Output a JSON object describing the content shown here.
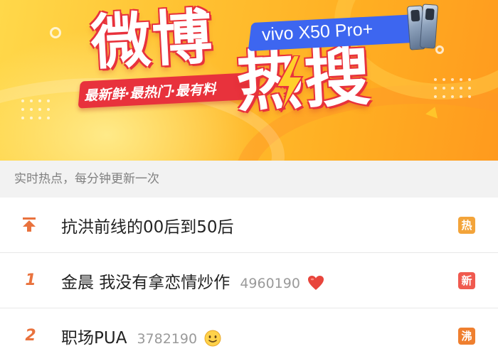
{
  "banner": {
    "title_part1": "微博",
    "title_part2": "热搜",
    "slogan": "最新鲜·最热门·最有料",
    "sponsor": "vivo X50 Pro+",
    "colors": {
      "background": "#ffc232",
      "accent_red": "#e8323c",
      "sponsor_blue": "#3d66f0"
    }
  },
  "subheader": {
    "text": "实时热点，每分钟更新一次"
  },
  "list": {
    "items": [
      {
        "rank": "",
        "rank_icon": "pin-top-icon",
        "topic": "抗洪前线的00后到50后",
        "count": "",
        "emoji": "",
        "badge": "热",
        "badge_color": "#f3a43a"
      },
      {
        "rank": "1",
        "rank_icon": "",
        "topic": "金晨 我没有拿恋情炒作",
        "count": "4960190",
        "emoji": "heart-icon",
        "badge": "新",
        "badge_color": "#f05a4f"
      },
      {
        "rank": "2",
        "rank_icon": "",
        "topic": "职场PUA",
        "count": "3782190",
        "emoji": "smile-emoji-icon",
        "badge": "沸",
        "badge_color": "#ef7f2f"
      }
    ]
  }
}
